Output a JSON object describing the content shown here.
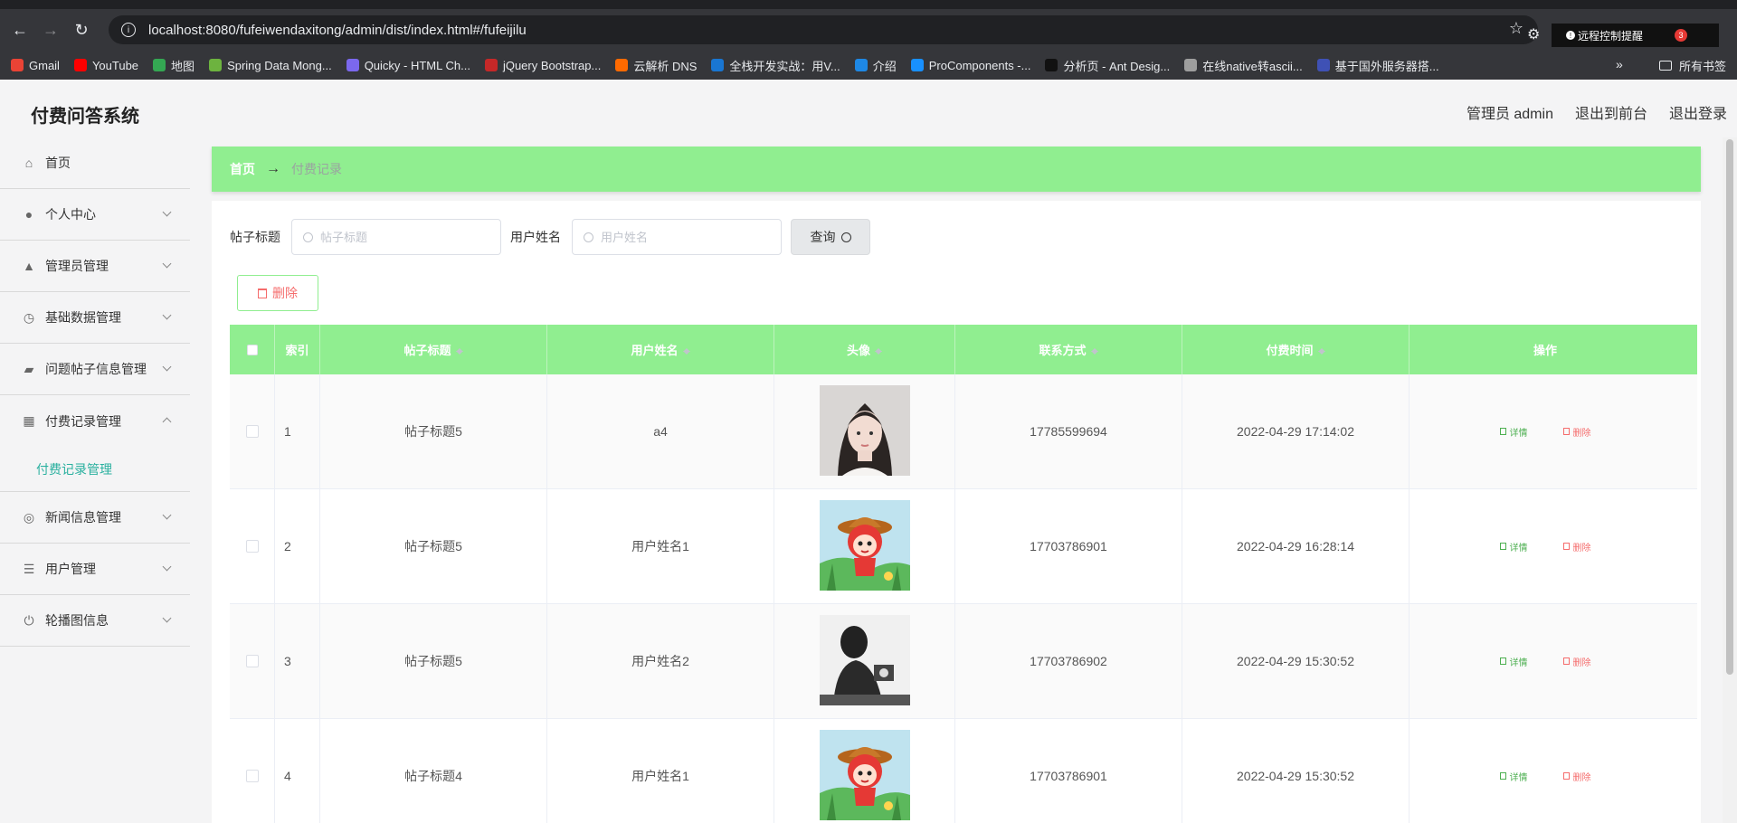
{
  "browser": {
    "url": "localhost:8080/fufeiwendaxitong/admin/dist/index.html#/fufeijilu",
    "remote_tip": "远程控制提醒",
    "remote_badge": "3",
    "bookmarks": [
      {
        "label": "Gmail",
        "color": "#ea4335"
      },
      {
        "label": "YouTube",
        "color": "#ff0000"
      },
      {
        "label": "地图",
        "color": "#34a853"
      },
      {
        "label": "Spring Data Mong...",
        "color": "#6db33f"
      },
      {
        "label": "Quicky - HTML Ch...",
        "color": "#7b68ee"
      },
      {
        "label": "jQuery Bootstrap...",
        "color": "#c62828"
      },
      {
        "label": "云解析 DNS",
        "color": "#ff6a00"
      },
      {
        "label": "全栈开发实战：用V...",
        "color": "#1976d2"
      },
      {
        "label": "介绍",
        "color": "#1e88e5"
      },
      {
        "label": "ProComponents -...",
        "color": "#1890ff"
      },
      {
        "label": "分析页 - Ant Desig...",
        "color": "#111111"
      },
      {
        "label": "在线native转ascii...",
        "color": "#9e9e9e"
      },
      {
        "label": "基于国外服务器搭...",
        "color": "#3f51b5"
      }
    ],
    "all_bookmarks": "所有书签"
  },
  "header": {
    "title": "付费问答系统",
    "admin": "管理员 admin",
    "to_front": "退出到前台",
    "logout": "退出登录"
  },
  "sidebar": {
    "items": [
      {
        "label": "首页",
        "icon": "home-icon"
      },
      {
        "label": "个人中心",
        "icon": "user-icon"
      },
      {
        "label": "管理员管理",
        "icon": "admin-icon"
      },
      {
        "label": "基础数据管理",
        "icon": "clock-icon"
      },
      {
        "label": "问题帖子信息管理",
        "icon": "ticket-icon"
      },
      {
        "label": "付费记录管理",
        "icon": "grid-icon"
      },
      {
        "label": "新闻信息管理",
        "icon": "target-icon"
      },
      {
        "label": "用户管理",
        "icon": "list-icon"
      },
      {
        "label": "轮播图信息",
        "icon": "power-icon"
      }
    ],
    "submenu": "付费记录管理"
  },
  "breadcrumb": {
    "home": "首页",
    "arrow": "→",
    "current": "付费记录"
  },
  "search": {
    "title_label": "帖子标题",
    "title_placeholder": "帖子标题",
    "user_label": "用户姓名",
    "user_placeholder": "用户姓名",
    "query": "查询",
    "delete": "删除"
  },
  "table": {
    "headers": {
      "index": "索引",
      "title": "帖子标题",
      "username": "用户姓名",
      "avatar": "头像",
      "contact": "联系方式",
      "pay_time": "付费时间",
      "actions": "操作"
    },
    "rows": [
      {
        "index": "1",
        "title": "帖子标题5",
        "username": "a4",
        "avatar": "photo-girl",
        "contact": "17785599694",
        "pay_time": "2022-04-29 17:14:02"
      },
      {
        "index": "2",
        "title": "帖子标题5",
        "username": "用户姓名1",
        "avatar": "cartoon-fox",
        "contact": "17703786901",
        "pay_time": "2022-04-29 16:28:14"
      },
      {
        "index": "3",
        "title": "帖子标题5",
        "username": "用户姓名2",
        "avatar": "photo-man",
        "contact": "17703786902",
        "pay_time": "2022-04-29 15:30:52"
      },
      {
        "index": "4",
        "title": "帖子标题4",
        "username": "用户姓名1",
        "avatar": "cartoon-fox",
        "contact": "17703786901",
        "pay_time": "2022-04-29 15:30:52"
      }
    ],
    "detail_label": "详情",
    "delete_label": "删除"
  },
  "colors": {
    "accent": "#90ee90",
    "submenu_active": "#2ab09f",
    "danger": "#f56c6c"
  }
}
